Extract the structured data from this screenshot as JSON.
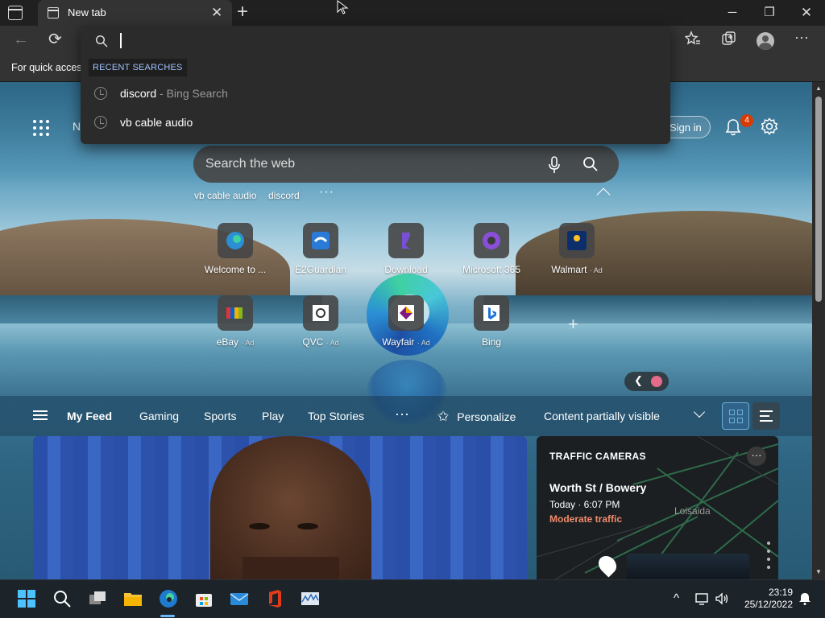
{
  "window": {
    "tab_title": "New tab",
    "tab_close": "✕",
    "new_tab": "+",
    "minimize": "─",
    "maximize": "❐",
    "close": "✕"
  },
  "toolbar": {
    "back": "←",
    "refresh": "⟳",
    "favorites_icon": "star-list-icon",
    "collections_icon": "collections-icon",
    "more": "···"
  },
  "favorites_bar": {
    "text": "For quick access"
  },
  "omnibox": {
    "value": "",
    "section_header": "RECENT SEARCHES",
    "items": [
      {
        "query": "discord",
        "suffix": " - Bing Search"
      },
      {
        "query": "vb cable audio",
        "suffix": ""
      }
    ]
  },
  "newtab": {
    "page_header_partial": "N",
    "signin_label": "Sign in",
    "notification_count": "4",
    "search_placeholder": "Search the web",
    "recent_chips": [
      "vb cable audio",
      "discord"
    ],
    "chips_more": "···",
    "quick_links": [
      {
        "label": "Welcome to ...",
        "ad": ""
      },
      {
        "label": "E2Guardian",
        "ad": ""
      },
      {
        "label": "Download",
        "ad": ""
      },
      {
        "label": "Microsoft 365",
        "ad": ""
      },
      {
        "label": "Walmart",
        "ad": "· Ad"
      },
      {
        "label": "eBay",
        "ad": "· Ad"
      },
      {
        "label": "QVC",
        "ad": "· Ad"
      },
      {
        "label": "Wayfair",
        "ad": "· Ad"
      },
      {
        "label": "Bing",
        "ad": ""
      }
    ],
    "add_link": "+"
  },
  "feed": {
    "tabs": [
      "My Feed",
      "Gaming",
      "Sports",
      "Play",
      "Top Stories"
    ],
    "more": "···",
    "personalize": "Personalize",
    "content_visibility": "Content partially visible"
  },
  "traffic": {
    "title": "TRAFFIC CAMERAS",
    "location": "Worth St / Bowery",
    "time": "Today · 6:07 PM",
    "status": "Moderate traffic",
    "neighborhood": "Loisaida",
    "more": "···"
  },
  "taskbar": {
    "time": "23:19",
    "date": "25/12/2022",
    "tray_chevron": "^"
  },
  "colors": {
    "accent": "#6cb8f6",
    "status_moderate": "#f28b6e",
    "badge": "#d83b01",
    "omni_header": "#9fc3ff"
  }
}
